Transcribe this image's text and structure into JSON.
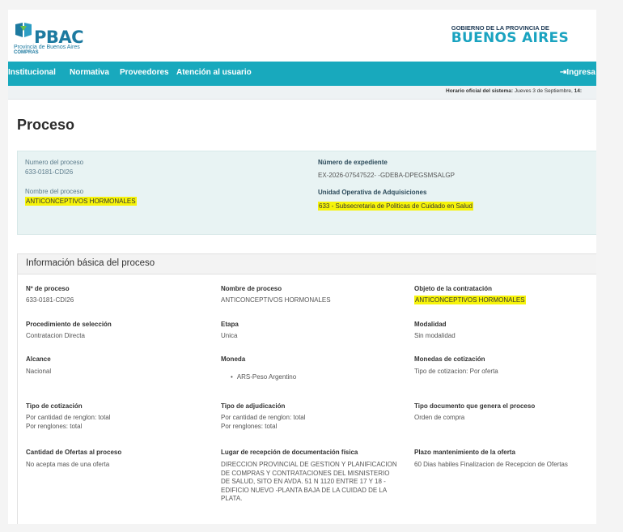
{
  "header": {
    "logo_text": "PBAC",
    "logo_subtitle": "Provincia de Buenos Aires",
    "logo_subtitle2": "COMPRAS",
    "gov_top": "GOBIERNO DE LA PROVINCIA DE",
    "gov_main": "BUENOS AIRES"
  },
  "nav": {
    "items": [
      "Institucional",
      "Normativa",
      "Proveedores",
      "Atención al usuario"
    ],
    "login": "Ingresa"
  },
  "system_time": {
    "label": "Horario oficial del sistema:",
    "value": "Jueves 3 de Septiembre,",
    "time": "14:"
  },
  "page_title": "Proceso",
  "summary": {
    "numero_label": "Numero del proceso",
    "numero_value": "633-0181-CDI26",
    "nombre_label": "Nombre del proceso",
    "nombre_value": "ANTICONCEPTIVOS HORMONALES",
    "expediente_label": "Número de expediente",
    "expediente_value": "EX-2026-07547522- -GDEBA-DPEGSMSALGP",
    "unidad_label": "Unidad Operativa de Adquisiciones",
    "unidad_value": "633 - Subsecretaria de Politicas de Cuidado en Salud"
  },
  "card": {
    "title": "Información básica del proceso",
    "fields": {
      "nro": {
        "label": "Nº de proceso",
        "value": "633-0181-CDI26"
      },
      "nombre": {
        "label": "Nombre de proceso",
        "value": "ANTICONCEPTIVOS HORMONALES"
      },
      "objeto": {
        "label": "Objeto de la contratación",
        "value": "ANTICONCEPTIVOS HORMONALES"
      },
      "procedimiento": {
        "label": "Procedimiento de selección",
        "value": "Contratacion Directa"
      },
      "etapa": {
        "label": "Etapa",
        "value": "Unica"
      },
      "modalidad": {
        "label": "Modalidad",
        "value": "Sin modalidad"
      },
      "alcance": {
        "label": "Alcance",
        "value": "Nacional"
      },
      "moneda": {
        "label": "Moneda",
        "value": "ARS-Peso Argentino"
      },
      "monedas_cot": {
        "label": "Monedas de cotización",
        "value": "Tipo de cotizacion: Por oferta"
      },
      "tipo_cot": {
        "label": "Tipo de cotización",
        "value1": "Por cantidad de renglon: total",
        "value2": "Por renglones: total"
      },
      "tipo_adj": {
        "label": "Tipo de adjudicación",
        "value1": "Por cantidad de renglon: total",
        "value2": "Por renglones: total"
      },
      "tipo_doc": {
        "label": "Tipo documento que genera el proceso",
        "value": "Orden de compra"
      },
      "cantidad_ofertas": {
        "label": "Cantidad de Ofertas al proceso",
        "value": "No acepta mas de una oferta"
      },
      "lugar": {
        "label": "Lugar de recepción de documentación física",
        "value": "DIRECCION PROVINCIAL DE GESTION Y PLANIFICACION DE COMPRAS Y CONTRATACIONES DEL MISNISTERIO DE SALUD, SITO EN AVDA. 51 N 1120 ENTRE 17 Y 18 -EDIFICIO NUEVO -PLANTA BAJA DE LA CUIDAD DE LA PLATA."
      },
      "plazo": {
        "label": "Plazo mantenimiento de la oferta",
        "value": "60 Dias habiles Finalizacion de Recepcion de Ofertas"
      }
    }
  },
  "colors": {
    "nav": "#18a9bd",
    "highlight": "#f6f30a",
    "brand": "#1d7aa0"
  }
}
